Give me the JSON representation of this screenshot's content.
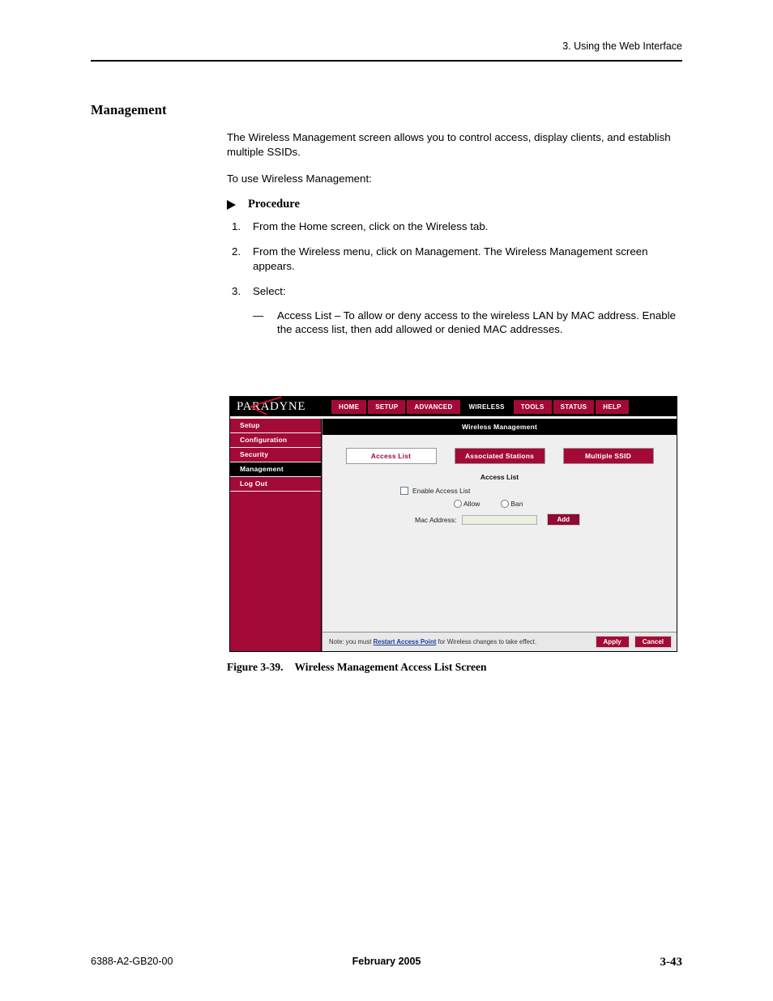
{
  "page": {
    "running_head": "3. Using the Web Interface",
    "section_title": "Management",
    "intro_paragraph": "The Wireless Management screen allows you to control access, display clients, and establish multiple SSIDs.",
    "intro_paragraph_2": "To use Wireless Management:",
    "procedure_label": "Procedure",
    "steps": [
      {
        "num": "1.",
        "text": "From the Home screen, click on the Wireless tab."
      },
      {
        "num": "2.",
        "text": "From the Wireless menu, click on Management. The Wireless Management screen appears."
      },
      {
        "num": "3.",
        "text": "Select:"
      }
    ],
    "sub_items": [
      {
        "dash": "—",
        "text": "Access List – To allow or deny access to the wireless LAN by MAC address. Enable the access list, then add allowed or denied MAC addresses."
      }
    ],
    "caption_number": "Figure 3-39.",
    "caption_text": "Wireless Management Access List Screen",
    "footer_left": "6388-A2-GB20-00",
    "footer_center": "February 2005",
    "footer_right": "3-43"
  },
  "figure": {
    "logo_text": "PARADYNE",
    "nav_tabs": [
      {
        "label": "HOME",
        "active": false
      },
      {
        "label": "SETUP",
        "active": false
      },
      {
        "label": "ADVANCED",
        "active": false
      },
      {
        "label": "WIRELESS",
        "active": true
      },
      {
        "label": "TOOLS",
        "active": false
      },
      {
        "label": "STATUS",
        "active": false
      },
      {
        "label": "HELP",
        "active": false
      }
    ],
    "sidebar_items": [
      {
        "label": "Setup",
        "active": false
      },
      {
        "label": "Configuration",
        "active": false
      },
      {
        "label": "Security",
        "active": false
      },
      {
        "label": "Management",
        "active": true
      },
      {
        "label": "Log Out",
        "active": false
      }
    ],
    "panel_title": "Wireless Management",
    "subtabs": [
      {
        "label": "Access List",
        "active": true
      },
      {
        "label": "Associated Stations",
        "active": false
      },
      {
        "label": "Multiple SSID",
        "active": false
      }
    ],
    "access_heading": "Access List",
    "enable_checkbox_label": "Enable Access List",
    "radio_allow_label": "Allow",
    "radio_ban_label": "Ban",
    "mac_label": "Mac Address:",
    "mac_value": "",
    "add_button": "Add",
    "note_prefix": "Note: you must ",
    "note_link": "Restart Access Point",
    "note_suffix": " for Wireless changes to take effect.",
    "apply_button": "Apply",
    "cancel_button": "Cancel"
  },
  "colors": {
    "brand_maroon": "#A30A38",
    "brand_red_accent": "#C8102E",
    "panel_bg": "#EFEFEF",
    "input_bg": "#EDEDE0",
    "link_blue": "#1A3FA0"
  }
}
